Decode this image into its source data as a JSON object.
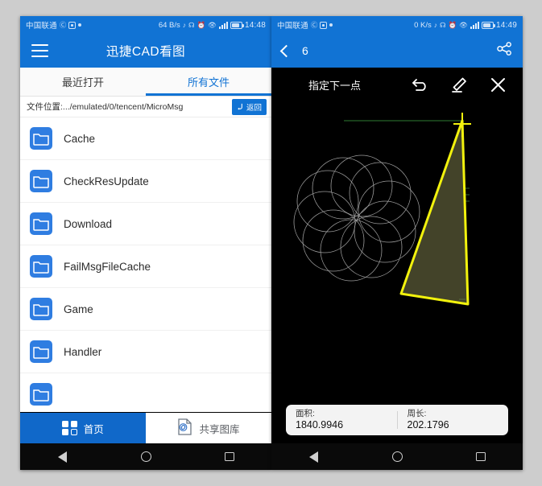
{
  "left_phone": {
    "status_bar": {
      "carrier": "中国联通",
      "net_speed": "64 B/s",
      "time": "14:48"
    },
    "app_bar": {
      "menu_icon": "hamburger-icon",
      "title": "迅捷CAD看图"
    },
    "tabs": [
      {
        "label": "最近打开",
        "active": false
      },
      {
        "label": "所有文件",
        "active": true
      }
    ],
    "path_row": {
      "path_text": "文件位置:.../emulated/0/tencent/MicroMsg",
      "back_button": "返回"
    },
    "files": [
      {
        "name": "Cache",
        "icon": "folder-icon"
      },
      {
        "name": "CheckResUpdate",
        "icon": "folder-icon"
      },
      {
        "name": "Download",
        "icon": "folder-icon"
      },
      {
        "name": "FailMsgFileCache",
        "icon": "folder-icon"
      },
      {
        "name": "Game",
        "icon": "folder-icon"
      },
      {
        "name": "Handler",
        "icon": "folder-icon"
      },
      {
        "name": "",
        "icon": "folder-icon"
      }
    ],
    "bottom_nav": [
      {
        "label": "首页",
        "icon": "grid-icon",
        "active": true
      },
      {
        "label": "共享图库",
        "icon": "shared-gallery-icon",
        "active": false
      }
    ]
  },
  "right_phone": {
    "status_bar": {
      "carrier": "中国联通",
      "net_speed": "0 K/s",
      "time": "14:49"
    },
    "app_bar": {
      "back_icon": "chevron-left-icon",
      "title": "6",
      "share_icon": "share-icon"
    },
    "cad_toolbar": {
      "hint": "指定下一点",
      "tools": [
        {
          "name": "undo-icon"
        },
        {
          "name": "eraser-icon"
        },
        {
          "name": "close-icon"
        }
      ]
    },
    "measurements": [
      {
        "label": "面积:",
        "value": "1840.9946"
      },
      {
        "label": "周长:",
        "value": "202.1796"
      }
    ]
  },
  "android_nav": {
    "back": "back-triangle-icon",
    "home": "home-circle-icon",
    "recents": "recents-square-icon"
  },
  "colors": {
    "brand_blue": "#1173d4",
    "nav_active_blue": "#1068c9",
    "folder_blue": "#2f7de1",
    "cad_yellow": "#f2f20d",
    "cad_green": "#2e7d32",
    "canvas_black": "#000000"
  }
}
